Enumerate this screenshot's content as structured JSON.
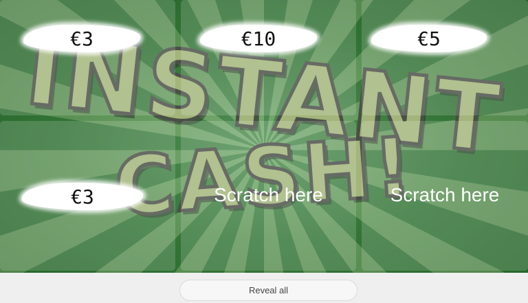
{
  "game": {
    "title_line1": "INSTANT",
    "title_line2": "CASH!",
    "colors": {
      "accent": "#2f7a33",
      "title_fill": "#a3b57a"
    }
  },
  "cells": [
    {
      "state": "revealed",
      "prize": "€3"
    },
    {
      "state": "revealed",
      "prize": "€10"
    },
    {
      "state": "revealed",
      "prize": "€5"
    },
    {
      "state": "revealed",
      "prize": "€3"
    },
    {
      "state": "covered",
      "label": "Scratch here"
    },
    {
      "state": "covered",
      "label": "Scratch here"
    }
  ],
  "controls": {
    "reveal_all_label": "Reveal all"
  }
}
